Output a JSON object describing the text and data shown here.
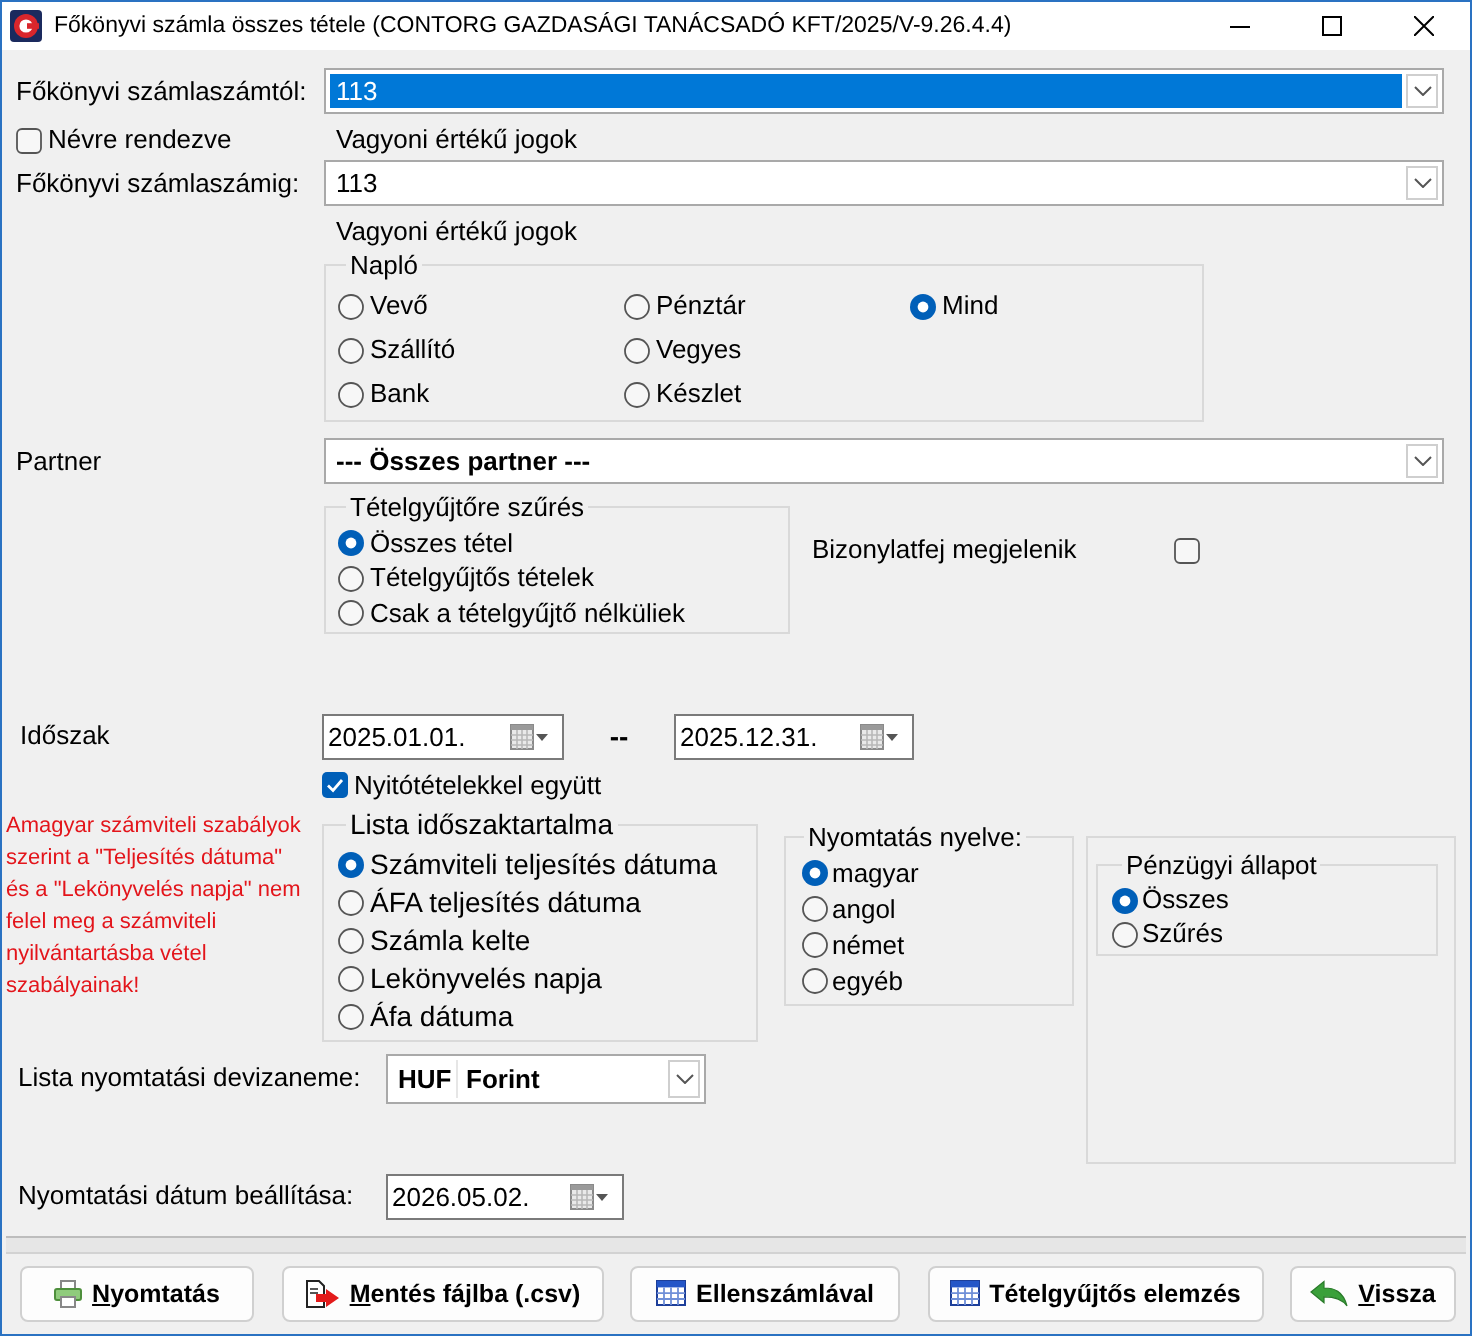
{
  "window": {
    "title": "Főkönyvi számla összes tétele (CONTORG GAZDASÁGI TANÁCSADÓ KFT/2025/V-9.26.4.4)"
  },
  "account_from": {
    "label": "Főkönyvi számlaszámtól:",
    "value": "113",
    "focused": true,
    "account_name": "Vagyoni értékű jogok"
  },
  "sort_by_name": {
    "label": "Névre rendezve",
    "checked": false
  },
  "account_to": {
    "label": "Főkönyvi számlaszámig:",
    "value": "113",
    "focused": false,
    "account_name": "Vagyoni értékű jogok"
  },
  "journal": {
    "title": "Napló",
    "columns": [
      [
        {
          "label": "Vevő",
          "selected": false
        },
        {
          "label": "Szállító",
          "selected": false
        },
        {
          "label": "Bank",
          "selected": false
        }
      ],
      [
        {
          "label": "Pénztár",
          "selected": false
        },
        {
          "label": "Vegyes",
          "selected": false
        },
        {
          "label": "Készlet",
          "selected": false
        }
      ],
      [
        {
          "label": "Mind",
          "selected": true
        }
      ]
    ]
  },
  "partner": {
    "label": "Partner",
    "value": "--- Összes partner ---"
  },
  "item_filter": {
    "title": "Tételgyűjtőre szűrés",
    "options": [
      {
        "label": "Összes tétel",
        "selected": true
      },
      {
        "label": "Tételgyűjtős tételek",
        "selected": false
      },
      {
        "label": "Csak a tételgyűjtő nélküliek",
        "selected": false
      }
    ]
  },
  "show_doc_header": {
    "label": "Bizonylatfej megjelenik",
    "checked": false
  },
  "period": {
    "label": "Időszak",
    "from": "2025.01.01.",
    "separator": "--",
    "to": "2025.12.31."
  },
  "with_opening": {
    "label": "Nyitótételekkel együtt",
    "checked": true
  },
  "warning": {
    "lines": [
      "Amagyar számviteli szabályok",
      "szerint a \"Teljesítés dátuma\"",
      "és a \"Lekönyvelés napja\" nem",
      "felel meg a számviteli",
      "nyilvántartásba vétel",
      "szabályainak!"
    ]
  },
  "list_period_content": {
    "title": "Lista időszaktartalma",
    "options": [
      {
        "label": "Számviteli teljesítés dátuma",
        "selected": true
      },
      {
        "label": "ÁFA teljesítés dátuma",
        "selected": false
      },
      {
        "label": "Számla kelte",
        "selected": false
      },
      {
        "label": "Lekönyvelés napja",
        "selected": false
      },
      {
        "label": "Áfa dátuma",
        "selected": false
      }
    ]
  },
  "print_language": {
    "title": "Nyomtatás nyelve:",
    "options": [
      {
        "label": "magyar",
        "selected": true
      },
      {
        "label": "angol",
        "selected": false
      },
      {
        "label": "német",
        "selected": false
      },
      {
        "label": "egyéb",
        "selected": false
      }
    ]
  },
  "financial_status": {
    "title": "Pénzügyi állapot",
    "options": [
      {
        "label": "Összes",
        "selected": true
      },
      {
        "label": "Szűrés",
        "selected": false
      }
    ]
  },
  "currency": {
    "label": "Lista nyomtatási devizaneme:",
    "code": "HUF",
    "name": "Forint"
  },
  "print_date": {
    "label": "Nyomtatási dátum beállítása:",
    "value": "2026.05.02."
  },
  "buttons": [
    {
      "kind": "print",
      "label": "Nyomtatás",
      "mnemonic": true
    },
    {
      "kind": "export",
      "label": "Mentés fájlba (.csv)",
      "mnemonic": true
    },
    {
      "kind": "table",
      "label": "Ellenszámlával",
      "mnemonic": false
    },
    {
      "kind": "table",
      "label": "Tételgyűjtős elemzés",
      "mnemonic": false
    },
    {
      "kind": "back",
      "label": "Vissza",
      "mnemonic": true
    }
  ]
}
